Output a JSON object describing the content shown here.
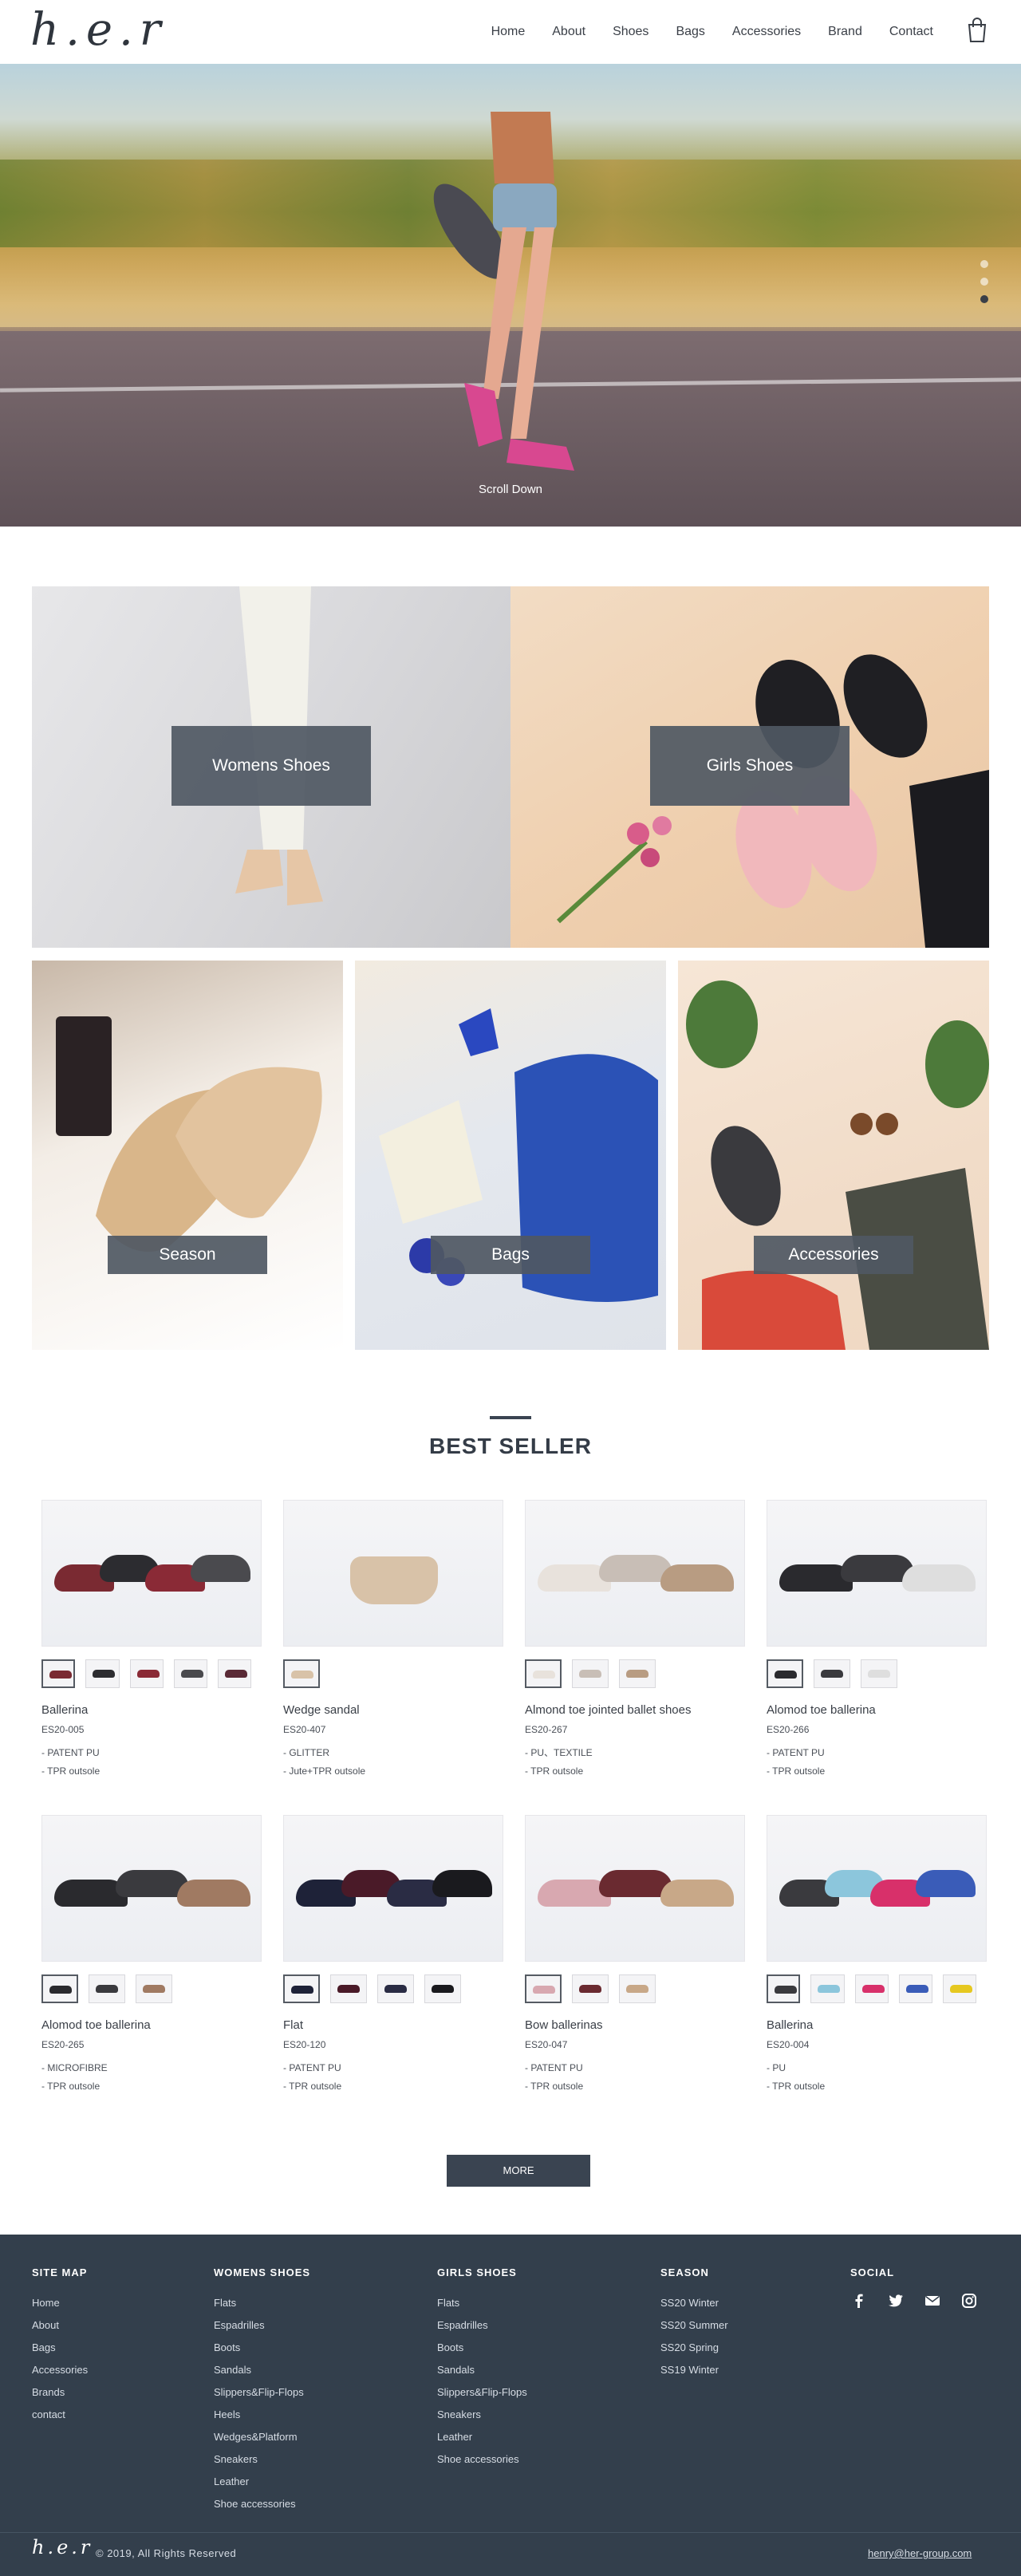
{
  "header": {
    "logo": "h.e.r",
    "nav": [
      "Home",
      "About",
      "Shoes",
      "Bags",
      "Accessories",
      "Brand",
      "Contact"
    ]
  },
  "hero": {
    "scroll_text": "Scroll Down",
    "slides": 3,
    "active_slide": 3
  },
  "categories": [
    {
      "label": "Womens Shoes"
    },
    {
      "label": "Girls Shoes"
    },
    {
      "label": "Season"
    },
    {
      "label": "Bags"
    },
    {
      "label": "Accessories"
    }
  ],
  "best_seller": {
    "title": "BEST SELLER",
    "products": [
      {
        "name": "Ballerina",
        "code": "ES20-005",
        "features": [
          "- PATENT PU",
          "- TPR outsole"
        ],
        "colors": [
          "#7a2a32",
          "#2c2c30",
          "#8a2a36",
          "#4a4a4e",
          "#5a2a36"
        ]
      },
      {
        "name": "Wedge sandal",
        "code": "ES20-407",
        "features": [
          "- GLITTER",
          "- Jute+TPR outsole"
        ],
        "colors": [
          "#d8c2a8"
        ]
      },
      {
        "name": "Almond toe jointed ballet shoes",
        "code": "ES20-267",
        "features": [
          "- PU、TEXTILE",
          "- TPR outsole"
        ],
        "colors": [
          "#e8e2dc",
          "#c8beb6",
          "#b89c82"
        ]
      },
      {
        "name": "Alomod toe ballerina",
        "code": "ES20-266",
        "features": [
          "- PATENT PU",
          "- TPR outsole"
        ],
        "colors": [
          "#2a2a2e",
          "#3a3a3e",
          "#dedede"
        ]
      },
      {
        "name": "Alomod toe ballerina",
        "code": "ES20-265",
        "features": [
          "- MICROFIBRE",
          "- TPR outsole"
        ],
        "colors": [
          "#2a2a2e",
          "#3a3a3e",
          "#a07a62"
        ]
      },
      {
        "name": "Flat",
        "code": "ES20-120",
        "features": [
          "- PATENT PU",
          "- TPR outsole"
        ],
        "colors": [
          "#1e2238",
          "#4a1a28",
          "#2a2c44",
          "#1a1a1e"
        ]
      },
      {
        "name": "Bow ballerinas",
        "code": "ES20-047",
        "features": [
          "- PATENT PU",
          "- TPR outsole"
        ],
        "colors": [
          "#d8a8b0",
          "#6a2a30",
          "#c8a888"
        ]
      },
      {
        "name": "Ballerina",
        "code": "ES20-004",
        "features": [
          "- PU",
          "- TPR outsole"
        ],
        "colors": [
          "#3a3a3e",
          "#8cc6dc",
          "#d8306a",
          "#3a5cb8",
          "#e6c820"
        ]
      }
    ],
    "more_label": "MORE"
  },
  "footer": {
    "columns": [
      {
        "title": "SITE MAP",
        "links": [
          "Home",
          "About",
          "Bags",
          "Accessories",
          "Brands",
          "contact"
        ]
      },
      {
        "title": "WOMENS SHOES",
        "links": [
          "Flats",
          "Espadrilles",
          "Boots",
          "Sandals",
          "Slippers&Flip-Flops",
          "Heels",
          "Wedges&Platform",
          "Sneakers",
          "Leather",
          "Shoe accessories"
        ]
      },
      {
        "title": "GIRLS SHOES",
        "links": [
          "Flats",
          "Espadrilles",
          "Boots",
          "Sandals",
          "Slippers&Flip-Flops",
          "Sneakers",
          "Leather",
          "Shoe accessories"
        ]
      },
      {
        "title": "SEASON",
        "links": [
          "SS20 Winter",
          "SS20 Summer",
          "SS20 Spring",
          "SS19 Winter"
        ]
      }
    ],
    "social_title": "SOCIAL",
    "social_icons": [
      "facebook-icon",
      "twitter-icon",
      "mail-icon",
      "instagram-icon"
    ],
    "logo": "h.e.r",
    "copyright": "© 2019, All Rights Reserved",
    "email": "henry@her-group.com"
  }
}
